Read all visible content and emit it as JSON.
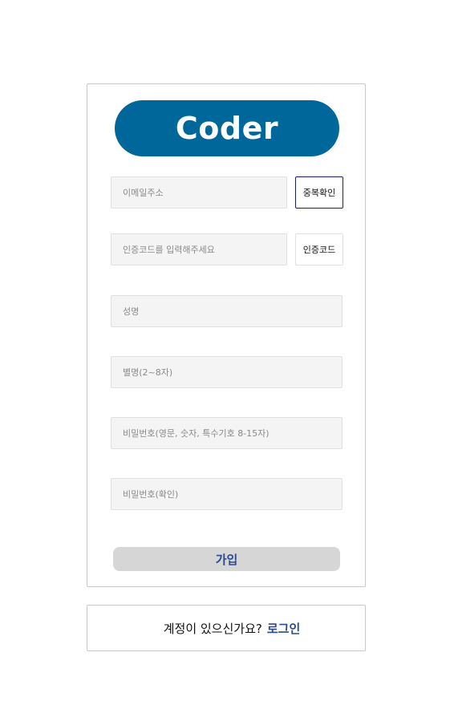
{
  "logo": {
    "text": "Coder",
    "bg_color": "#00679b"
  },
  "form": {
    "email_placeholder": "이메일주소",
    "dup_check_label": "중복확인",
    "code_placeholder": "인증코드를 입력해주세요",
    "code_button_label": "인증코드",
    "name_placeholder": "성명",
    "nickname_placeholder": "별명(2~8자)",
    "password_placeholder": "비밀번호(영문, 숫자, 특수기호 8-15자)",
    "password_confirm_placeholder": "비밀번호(확인)",
    "submit_label": "가입"
  },
  "footer": {
    "question": "계정이 있으신가요?",
    "login_link": "로그인",
    "link_color": "#2b4a8f"
  }
}
